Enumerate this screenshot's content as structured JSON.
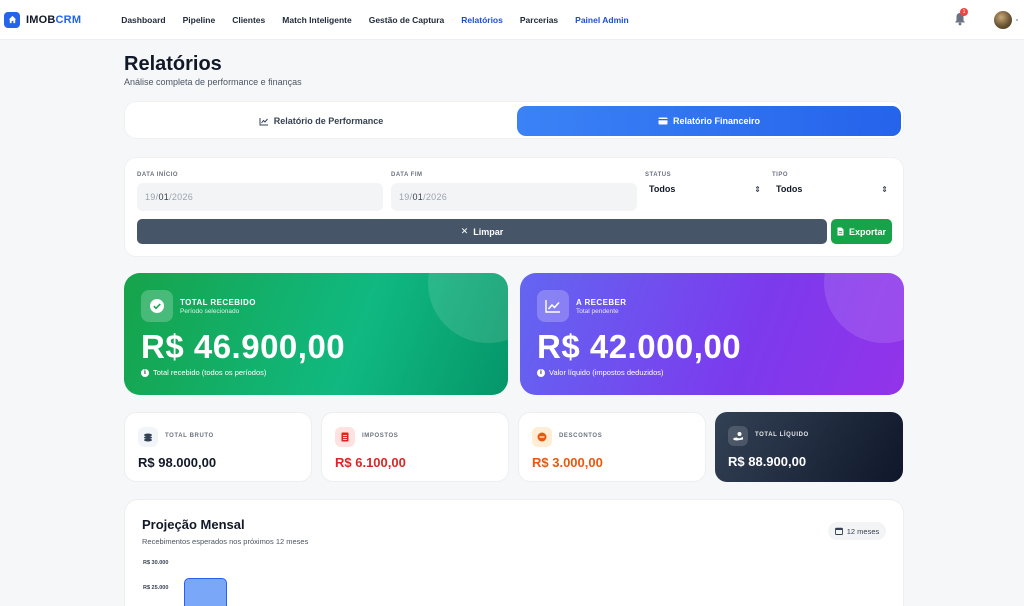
{
  "brand": {
    "prefix": "IMOB",
    "accent": "CRM"
  },
  "nav": [
    {
      "label": "Dashboard"
    },
    {
      "label": "Pipeline"
    },
    {
      "label": "Clientes"
    },
    {
      "label": "Match Inteligente"
    },
    {
      "label": "Gestão de Captura"
    },
    {
      "label": "Relatórios"
    },
    {
      "label": "Parcerias"
    },
    {
      "label": "Painel Admin"
    }
  ],
  "notifications": {
    "count": "1"
  },
  "header": {
    "title": "Relatórios",
    "subtitle": "Análise completa de performance e finanças"
  },
  "tabs": {
    "performance": "Relatório de Performance",
    "financial": "Relatório Financeiro"
  },
  "filters": {
    "start_label": "DATA INÍCIO",
    "start_day": "19",
    "start_month": "01",
    "start_year": "2026",
    "end_label": "DATA FIM",
    "end_day": "19",
    "end_month": "01",
    "end_year": "2026",
    "status_label": "STATUS",
    "status_value": "Todos",
    "type_label": "TIPO",
    "type_value": "Todos",
    "clear_label": "Limpar",
    "export_label": "Exportar"
  },
  "cards": {
    "received": {
      "title": "TOTAL RECEBIDO",
      "subtitle": "Período selecionado",
      "amount": "R$ 46.900,00",
      "note": "Total recebido (todos os períodos)"
    },
    "pending": {
      "title": "A RECEBER",
      "subtitle": "Total pendente",
      "amount": "R$ 42.000,00",
      "note": "Valor líquido (impostos deduzidos)"
    },
    "gross": {
      "title": "TOTAL BRUTO",
      "value": "R$ 98.000,00"
    },
    "taxes": {
      "title": "IMPOSTOS",
      "value": "R$ 6.100,00"
    },
    "discounts": {
      "title": "DESCONTOS",
      "value": "R$ 3.000,00"
    },
    "net": {
      "title": "TOTAL LÍQUIDO",
      "value": "R$ 88.900,00"
    }
  },
  "projection": {
    "title": "Projeção Mensal",
    "subtitle": "Recebimentos esperados nos próximos 12 meses",
    "range_badge": "12 meses",
    "ticks": [
      "R$ 30.000",
      "R$ 25.000"
    ]
  },
  "colors": {
    "primary": "#2563eb",
    "success": "#16a34a",
    "danger": "#dc2626",
    "warning": "#ea580c",
    "dark": "#0f172a"
  }
}
